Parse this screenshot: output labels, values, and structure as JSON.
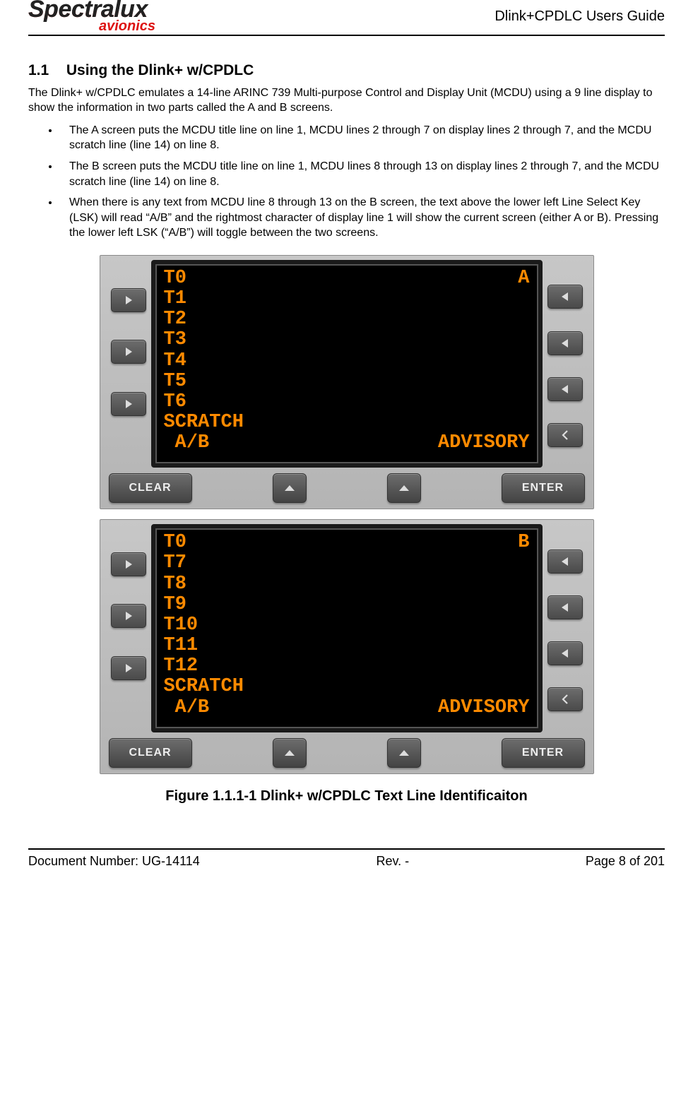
{
  "header": {
    "logo_main": "Spectralux",
    "logo_sub": "avionics",
    "doc_title": "Dlink+CPDLC Users Guide"
  },
  "section": {
    "number": "1.1",
    "title": "Using the Dlink+ w/CPDLC",
    "intro": "The Dlink+ w/CPDLC emulates a 14-line ARINC 739 Multi-purpose Control and Display Unit (MCDU) using a 9 line display to show the information in two parts called the A and B screens.",
    "bullets": [
      "The A screen puts the MCDU title line on line 1, MCDU lines 2 through 7 on display lines 2 through 7, and the MCDU scratch line (line 14) on line 8.",
      "The B screen puts the MCDU title line on line 1, MCDU lines 8 through 13 on display lines 2 through 7, and the MCDU scratch line (line 14) on line 8.",
      "When there is any text from MCDU line 8 through 13 on the B screen, the text above the lower left Line Select Key (LSK) will read “A/B” and the rightmost character of display line 1 will show the current screen (either A or B). Pressing the lower left LSK (“A/B”) will toggle between the two screens."
    ]
  },
  "figure": {
    "caption": "Figure 1.1.1-1 Dlink+ w/CPDLC Text Line Identificaiton",
    "buttons": {
      "clear": "CLEAR",
      "enter": "ENTER"
    },
    "screenA": {
      "title_left": "T0",
      "title_right": "A",
      "lines": [
        "T1",
        "T2",
        "T3",
        "T4",
        "T5",
        "T6"
      ],
      "scratch": "SCRATCH",
      "ab": "A/B",
      "advisory": "ADVISORY"
    },
    "screenB": {
      "title_left": "T0",
      "title_right": "B",
      "lines": [
        "T7",
        "T8",
        "T9",
        "T10",
        "T11",
        "T12"
      ],
      "scratch": "SCRATCH",
      "ab": "A/B",
      "advisory": "ADVISORY"
    }
  },
  "footer": {
    "left": "Document Number:  UG-14114",
    "center": "Rev. -",
    "right": "Page 8 of 201"
  }
}
